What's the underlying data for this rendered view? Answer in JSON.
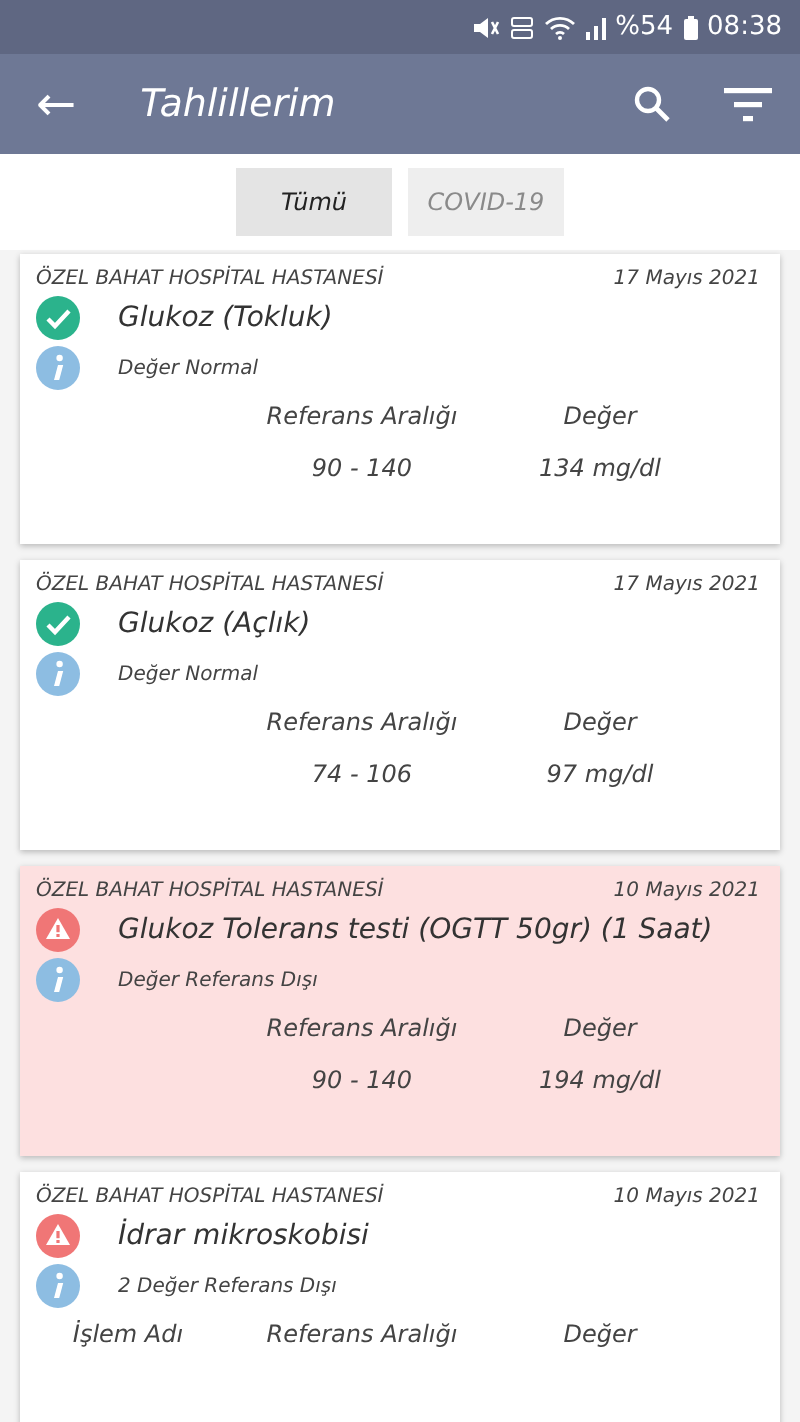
{
  "status_bar": {
    "battery": "%54",
    "time": "08:38"
  },
  "app_bar": {
    "back": "←",
    "title": "Tahlillerim"
  },
  "filters": [
    {
      "label": "Tümü",
      "selected": true
    },
    {
      "label": "COVID-19",
      "selected": false
    }
  ],
  "results": [
    {
      "kind": "normal",
      "hospital": "ÖZEL BAHAT HOSPİTAL HASTANESİ",
      "date": "17 Mayıs 2021",
      "title": "Glukoz (Tokluk)",
      "note": "Değer Normal",
      "columns": [
        "Referans Aralığı",
        "Değer"
      ],
      "values": [
        "90 - 140",
        "134 mg/dl"
      ]
    },
    {
      "kind": "normal",
      "hospital": "ÖZEL BAHAT HOSPİTAL HASTANESİ",
      "date": "17 Mayıs 2021",
      "title": "Glukoz (Açlık)",
      "note": "Değer Normal",
      "columns": [
        "Referans Aralığı",
        "Değer"
      ],
      "values": [
        "74 - 106",
        "97 mg/dl"
      ]
    },
    {
      "kind": "abnormal",
      "highlighted": true,
      "hospital": "ÖZEL BAHAT HOSPİTAL HASTANESİ",
      "date": "10 Mayıs 2021",
      "title": "Glukoz Tolerans testi (OGTT 50gr) (1 Saat)",
      "note": "Değer Referans Dışı",
      "columns": [
        "Referans Aralığı",
        "Değer"
      ],
      "values": [
        "90 - 140",
        "194 mg/dl"
      ]
    },
    {
      "kind": "abnormal",
      "highlighted": false,
      "hospital": "ÖZEL BAHAT HOSPİTAL HASTANESİ",
      "date": "10 Mayıs 2021",
      "title": "İdrar mikroskobisi",
      "note": "2 Değer Referans Dışı",
      "columns": [
        "İşlem Adı",
        "Referans Aralığı",
        "Değer"
      ]
    }
  ]
}
